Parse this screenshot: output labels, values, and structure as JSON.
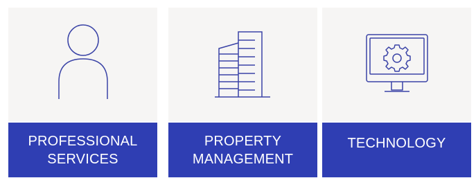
{
  "colors": {
    "accent": "#2f3eb3",
    "card_bg": "#f6f5f4",
    "label_text": "#ffffff",
    "icon_stroke": "#3a43a6"
  },
  "cards": [
    {
      "label": "PROFESSIONAL\nSERVICES",
      "icon": "person-icon"
    },
    {
      "label": "PROPERTY\nMANAGEMENT",
      "icon": "building-icon"
    },
    {
      "label": "TECHNOLOGY",
      "icon": "monitor-gear-icon"
    }
  ]
}
